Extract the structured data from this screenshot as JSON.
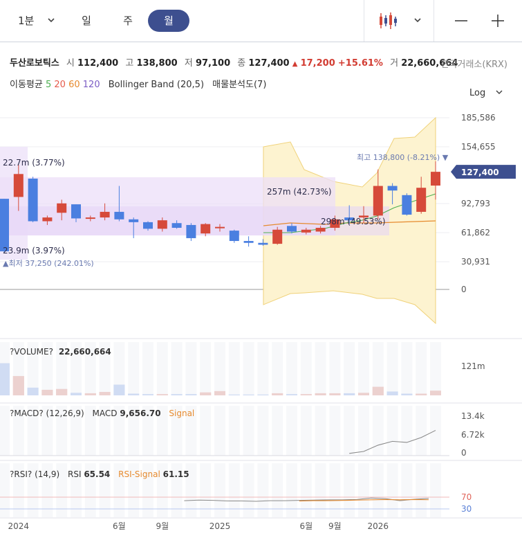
{
  "toolbar": {
    "period_select": "1분",
    "tabs": [
      "일",
      "주",
      "월"
    ],
    "active_tab": "월"
  },
  "quote": {
    "name": "두산로보틱스",
    "open_label": "시",
    "open": "112,400",
    "high_label": "고",
    "high": "138,800",
    "low_label": "저",
    "low": "97,100",
    "close_label": "종",
    "close": "127,400",
    "change_arrow": "▲",
    "change": "17,200",
    "change_pct": "+15.61%",
    "volume_label": "거",
    "volume": "22,660,664",
    "exchange": "한국거래소(KRX)"
  },
  "indicators": {
    "ma_label": "이동평균",
    "ma_periods": [
      "5",
      "20",
      "60",
      "120"
    ],
    "ma_colors": [
      "#4caf50",
      "#e65a4b",
      "#e68a2e",
      "#7b5cc4"
    ],
    "bb_label": "Bollinger Band (20,5)",
    "vp_label": "매물분석도(7)",
    "scale_select": "Log"
  },
  "colors": {
    "up": "#d64a3a",
    "down": "#4a7fe0",
    "bb_fill": "#fdf3d0",
    "bb_line": "#f0d27a",
    "vp_fill": "#f0e6fa",
    "accent": "#3d4f8f"
  },
  "chart_data": {
    "type": "candlestick",
    "scale": "log",
    "x_tick_labels": [
      "2024",
      "6월",
      "9월",
      "2025",
      "6월",
      "9월",
      "2026"
    ],
    "y_tick_labels": [
      "185,586",
      "154,655",
      "127,400",
      "92,793",
      "61,862",
      "30,931",
      "0"
    ],
    "last_price_label": "127,400",
    "candles": [
      {
        "o": 98000,
        "h": 98000,
        "l": 40000,
        "c": 42000
      },
      {
        "o": 100000,
        "h": 135000,
        "l": 85000,
        "c": 125000
      },
      {
        "o": 120000,
        "h": 122000,
        "l": 73000,
        "c": 74000
      },
      {
        "o": 74000,
        "h": 80000,
        "l": 70000,
        "c": 78000
      },
      {
        "o": 83000,
        "h": 97000,
        "l": 75000,
        "c": 93000
      },
      {
        "o": 92000,
        "h": 92000,
        "l": 73000,
        "c": 77000
      },
      {
        "o": 77000,
        "h": 80000,
        "l": 74000,
        "c": 78000
      },
      {
        "o": 78000,
        "h": 93000,
        "l": 75000,
        "c": 84000
      },
      {
        "o": 84000,
        "h": 112000,
        "l": 74000,
        "c": 76000
      },
      {
        "o": 76000,
        "h": 78000,
        "l": 56000,
        "c": 73000
      },
      {
        "o": 73000,
        "h": 74000,
        "l": 64000,
        "c": 66000
      },
      {
        "o": 66000,
        "h": 78000,
        "l": 63000,
        "c": 75000
      },
      {
        "o": 72000,
        "h": 75000,
        "l": 66000,
        "c": 67000
      },
      {
        "o": 70000,
        "h": 72000,
        "l": 53000,
        "c": 56000
      },
      {
        "o": 61000,
        "h": 72000,
        "l": 58000,
        "c": 71000
      },
      {
        "o": 67000,
        "h": 71000,
        "l": 63000,
        "c": 68000
      },
      {
        "o": 64000,
        "h": 65000,
        "l": 51000,
        "c": 53000
      },
      {
        "o": 53000,
        "h": 58000,
        "l": 47000,
        "c": 51000
      },
      {
        "o": 51000,
        "h": 55000,
        "l": 48000,
        "c": 49000
      },
      {
        "o": 50000,
        "h": 68000,
        "l": 49000,
        "c": 65000
      },
      {
        "o": 69000,
        "h": 72000,
        "l": 61000,
        "c": 63000
      },
      {
        "o": 62000,
        "h": 67000,
        "l": 60000,
        "c": 65000
      },
      {
        "o": 63000,
        "h": 69000,
        "l": 61000,
        "c": 67000
      },
      {
        "o": 67000,
        "h": 80000,
        "l": 64000,
        "c": 76000
      },
      {
        "o": 78000,
        "h": 91000,
        "l": 71000,
        "c": 75000
      },
      {
        "o": 78000,
        "h": 90000,
        "l": 72000,
        "c": 80000
      },
      {
        "o": 80000,
        "h": 130000,
        "l": 76000,
        "c": 112000
      },
      {
        "o": 112000,
        "h": 115000,
        "l": 92000,
        "c": 107000
      },
      {
        "o": 102000,
        "h": 104000,
        "l": 80000,
        "c": 81000
      },
      {
        "o": 84000,
        "h": 122000,
        "l": 82000,
        "c": 110000
      },
      {
        "o": 112400,
        "h": 138800,
        "l": 97100,
        "c": 127400
      }
    ],
    "annotations": {
      "high": "최고 138,800 (-8.21%)",
      "low": "최저 37,250 (242.01%)",
      "vp_labels": [
        "22.7m (3.77%)",
        "23.9m (3.97%)",
        "257m (42.73%)",
        "298m (49.53%)"
      ]
    },
    "volume": {
      "label": "VOLUME",
      "value": "22,660,664",
      "axis_label": "121m",
      "values": [
        75,
        45,
        18,
        13,
        15,
        6,
        5,
        8,
        25,
        4,
        3,
        3,
        3,
        3,
        7,
        10,
        2,
        2,
        2,
        5,
        3,
        3,
        5,
        5,
        5,
        6,
        20,
        9,
        4,
        4,
        11
      ]
    },
    "macd": {
      "label": "MACD",
      "params": "(12,26,9)",
      "macd_label": "MACD",
      "macd_value": "9,656.70",
      "signal_label": "Signal",
      "y_tick_labels": [
        "13.4k",
        "6.72k",
        "0"
      ],
      "values": [
        0,
        0,
        0,
        0,
        0,
        0,
        0,
        0,
        0,
        0,
        0,
        0,
        0,
        0,
        0,
        0,
        0,
        0,
        0,
        0,
        0,
        0,
        0,
        0,
        -200,
        500,
        2800,
        4200,
        3800,
        5600,
        8200
      ]
    },
    "rsi": {
      "label": "RSI",
      "params": "(14,9)",
      "rsi_label": "RSI",
      "rsi_value": "65.54",
      "signal_label": "RSI-Signal",
      "signal_value": "61.15",
      "y_tick_labels": [
        "70",
        "30"
      ],
      "values": [
        null,
        null,
        null,
        null,
        null,
        null,
        null,
        null,
        null,
        null,
        null,
        null,
        null,
        58,
        60,
        59,
        57,
        57,
        56,
        58,
        58,
        59,
        60,
        61,
        61,
        62,
        67,
        65,
        58,
        63,
        65.54
      ],
      "signal_values": [
        null,
        null,
        null,
        null,
        null,
        null,
        null,
        null,
        null,
        null,
        null,
        null,
        null,
        null,
        null,
        null,
        null,
        null,
        null,
        null,
        null,
        57,
        58,
        58,
        59,
        60,
        61,
        62,
        61,
        62,
        61.15
      ]
    }
  }
}
